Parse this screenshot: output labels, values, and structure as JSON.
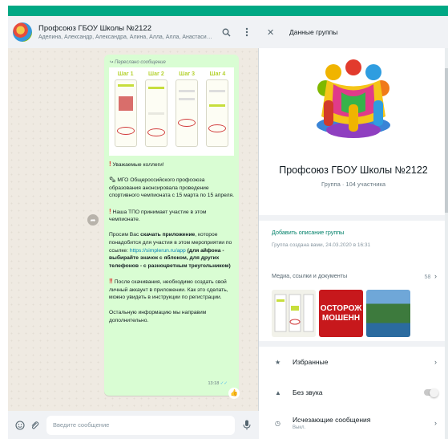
{
  "chat": {
    "title": "Профсоюз ГБОУ Школы №2122",
    "members": "Аделина, Александр, Александра, Алина, Алла, Алла, Анастасия, Анастас..."
  },
  "message": {
    "forwarded_label": "Переслано сообщение",
    "promo_steps": [
      "Шаг 1",
      "Шаг 2",
      "Шаг 3",
      "Шаг 4"
    ],
    "p1": "Уважаемые коллеги!",
    "p2": "МГО Общероссийского профсоюза образования анонсировала проведение спортивного чемпионата с 15 марта по 15 апреля.",
    "p3": "Наша ТПО принимает участие в этом чемпионате.",
    "p4_a": "Просим Вас ",
    "p4_b": "скачать приложение",
    "p4_c": ", которое понадобится для участия в этом мероприятии по ссылке: ",
    "p4_link": "https://simplerun.ru/app",
    "p4_d": " (для айфона - выбирайте значок с яблоком, для других телефонов - с разноцветным треугольником)",
    "p5": "После скачивания, необходимо создать свой личный аккаунт в приложении. Как это сделать, можно увидеть в инструкции по регистрации.",
    "p6": "Остальную информацию мы направим дополнительно.",
    "time": "13:18",
    "reaction": "👍"
  },
  "composer": {
    "placeholder": "Введите сообщение"
  },
  "info": {
    "header_title": "Данные группы",
    "group_name": "Профсоюз ГБОУ Школы №2122",
    "group_sub": "Группа · 104 участника",
    "add_description": "Добавить описание группы",
    "created": "Группа создана вами, 24.03.2020 в 16:31",
    "media_label": "Медиа, ссылки и документы",
    "media_count": "58",
    "media_thumb2_line1": "ОСТОРОЖ",
    "media_thumb2_line2": "МОШЕНН",
    "favorites": "Избранные",
    "mute": "Без звука",
    "disappearing": "Исчезающие сообщения",
    "disappearing_state": "Выкл."
  },
  "colors": {
    "accent": "#00a884",
    "bubble": "#d9fdd3",
    "link": "#027eb5"
  },
  "icons": [
    "search-icon",
    "menu-icon",
    "close-icon",
    "emoji-icon",
    "attach-icon",
    "mic-icon",
    "star-icon",
    "bell-icon",
    "timer-icon",
    "chevron-right-icon",
    "forward-icon"
  ]
}
